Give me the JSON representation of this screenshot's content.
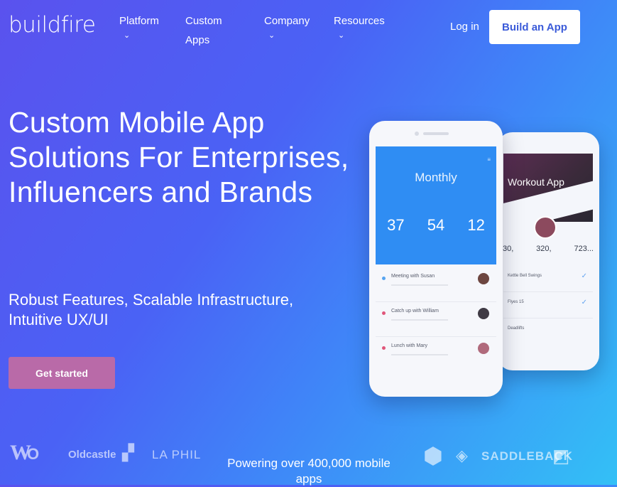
{
  "nav": {
    "logo": "buildfire",
    "items": [
      {
        "label": "Platform"
      },
      {
        "label": "Custom Apps"
      },
      {
        "label": "Company"
      },
      {
        "label": "Resources"
      }
    ],
    "login": "Log in",
    "cta": "Build an App"
  },
  "hero": {
    "title": "Custom Mobile App Solutions For Enterprises, Influencers and Brands",
    "subtitle": "Robust Features, Scalable Infrastructure, Intuitive UX/UI",
    "button": "Get started"
  },
  "phone_front": {
    "title": "Monthly",
    "stats": [
      {
        "value": "37"
      },
      {
        "value": "54"
      },
      {
        "value": "12"
      }
    ],
    "meetings": [
      {
        "title": "Meeting with Susan",
        "color": "#56a4f0"
      },
      {
        "title": "Catch up with William",
        "color": "#e0567a"
      },
      {
        "title": "Lunch with Mary",
        "color": "#e0567a"
      }
    ]
  },
  "phone_back": {
    "title": "Workout App",
    "stats": [
      "30,",
      "320,",
      "723..."
    ],
    "items": [
      "Kettle Bell Swings",
      "Flyes 15",
      "Deadlifts"
    ]
  },
  "logos": [
    "Oldcastle",
    "LA PHIL",
    "SADDLEBACK"
  ],
  "footer": {
    "powering": "Powering over 400,000 mobile apps"
  }
}
